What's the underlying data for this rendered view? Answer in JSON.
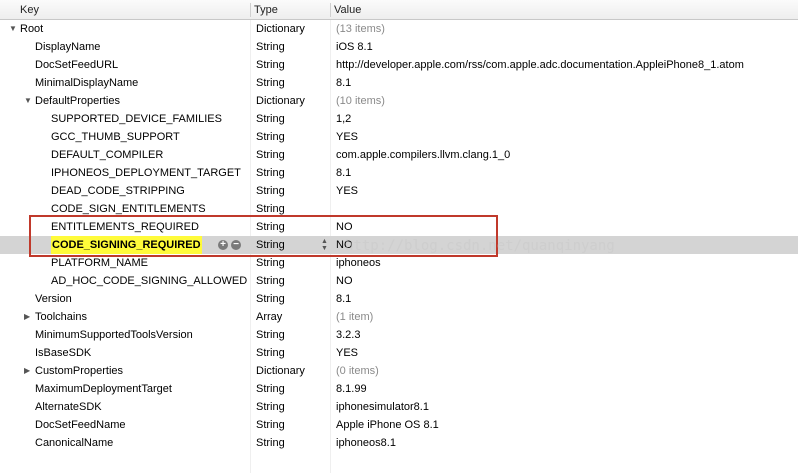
{
  "header": {
    "key": "Key",
    "type": "Type",
    "value": "Value"
  },
  "rows": [
    {
      "key": "Root",
      "type": "Dictionary",
      "value": "(13 items)",
      "level": 0,
      "disclosure": "open",
      "muted": true
    },
    {
      "key": "DisplayName",
      "type": "String",
      "value": "iOS 8.1",
      "level": 1
    },
    {
      "key": "DocSetFeedURL",
      "type": "String",
      "value": "http://developer.apple.com/rss/com.apple.adc.documentation.AppleiPhone8_1.atom",
      "level": 1
    },
    {
      "key": "MinimalDisplayName",
      "type": "String",
      "value": "8.1",
      "level": 1
    },
    {
      "key": "DefaultProperties",
      "type": "Dictionary",
      "value": "(10 items)",
      "level": 1,
      "disclosure": "open",
      "muted": true
    },
    {
      "key": "SUPPORTED_DEVICE_FAMILIES",
      "type": "String",
      "value": "1,2",
      "level": 2
    },
    {
      "key": "GCC_THUMB_SUPPORT",
      "type": "String",
      "value": "YES",
      "level": 2
    },
    {
      "key": "DEFAULT_COMPILER",
      "type": "String",
      "value": "com.apple.compilers.llvm.clang.1_0",
      "level": 2
    },
    {
      "key": "IPHONEOS_DEPLOYMENT_TARGET",
      "type": "String",
      "value": "8.1",
      "level": 2
    },
    {
      "key": "DEAD_CODE_STRIPPING",
      "type": "String",
      "value": "YES",
      "level": 2
    },
    {
      "key": "CODE_SIGN_ENTITLEMENTS",
      "type": "String",
      "value": "",
      "level": 2
    },
    {
      "key": "ENTITLEMENTS_REQUIRED",
      "type": "String",
      "value": "NO",
      "level": 2
    },
    {
      "key": "CODE_SIGNING_REQUIRED",
      "type": "String",
      "value": "NO",
      "level": 2,
      "selected": true
    },
    {
      "key": "PLATFORM_NAME",
      "type": "String",
      "value": "iphoneos",
      "level": 2
    },
    {
      "key": "AD_HOC_CODE_SIGNING_ALLOWED",
      "type": "String",
      "value": "NO",
      "level": 2
    },
    {
      "key": "Version",
      "type": "String",
      "value": "8.1",
      "level": 1
    },
    {
      "key": "Toolchains",
      "type": "Array",
      "value": "(1 item)",
      "level": 1,
      "disclosure": "closed",
      "muted": true
    },
    {
      "key": "MinimumSupportedToolsVersion",
      "type": "String",
      "value": "3.2.3",
      "level": 1
    },
    {
      "key": "IsBaseSDK",
      "type": "String",
      "value": "YES",
      "level": 1
    },
    {
      "key": "CustomProperties",
      "type": "Dictionary",
      "value": "(0 items)",
      "level": 1,
      "disclosure": "closed",
      "muted": true
    },
    {
      "key": "MaximumDeploymentTarget",
      "type": "String",
      "value": "8.1.99",
      "level": 1
    },
    {
      "key": "AlternateSDK",
      "type": "String",
      "value": "iphonesimulator8.1",
      "level": 1
    },
    {
      "key": "DocSetFeedName",
      "type": "String",
      "value": "Apple iPhone OS 8.1",
      "level": 1
    },
    {
      "key": "CanonicalName",
      "type": "String",
      "value": "iphoneos8.1",
      "level": 1
    }
  ],
  "watermark": "http://blog.csdn.net/quanqinyang",
  "colors": {
    "highlight": "#fffb3a",
    "annotation_box": "#c0392b",
    "selection": "#d4d4d4"
  }
}
